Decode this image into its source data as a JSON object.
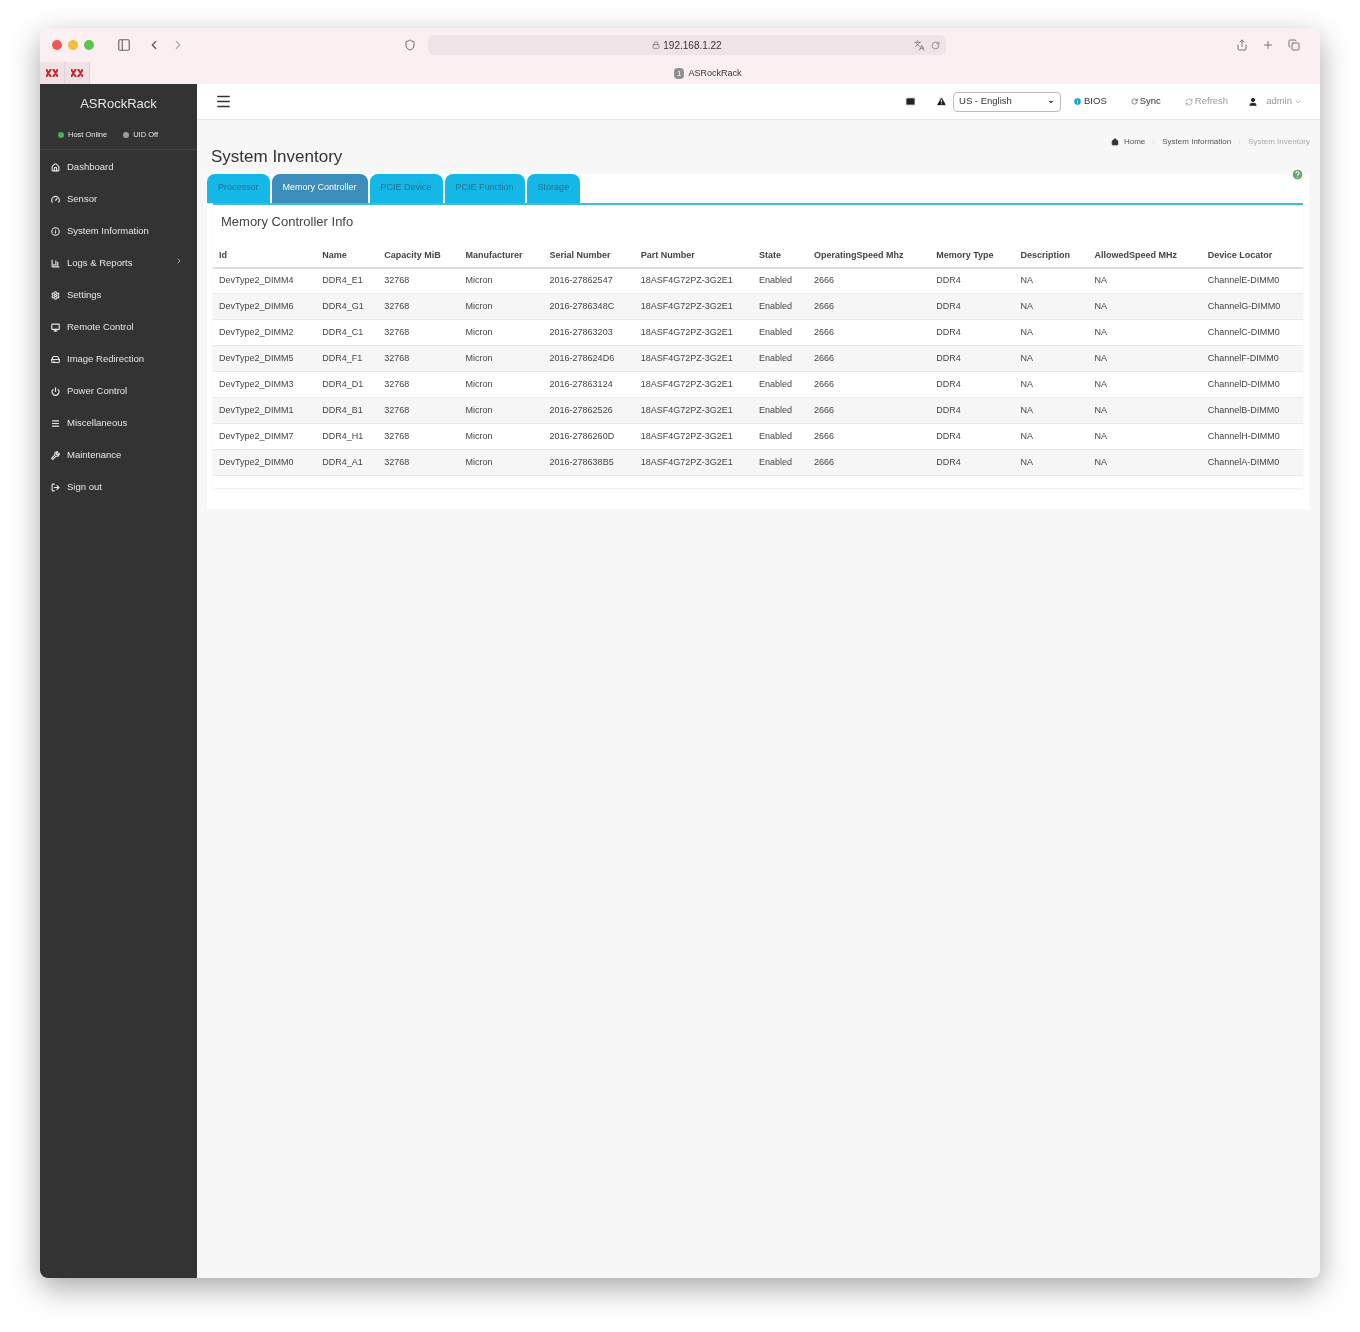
{
  "browser": {
    "url": "192.168.1.22",
    "tab_badge": "1",
    "tab_title": "ASRockRack"
  },
  "sidebar": {
    "brand": "ASRockRack",
    "status": [
      {
        "label": "Host Online",
        "color": "#4caf50"
      },
      {
        "label": "UID Off",
        "color": "#9e9e9e"
      }
    ],
    "items": [
      {
        "label": "Dashboard",
        "submenu": false
      },
      {
        "label": "Sensor",
        "submenu": false
      },
      {
        "label": "System Information",
        "submenu": false
      },
      {
        "label": "Logs & Reports",
        "submenu": true
      },
      {
        "label": "Settings",
        "submenu": false
      },
      {
        "label": "Remote Control",
        "submenu": false
      },
      {
        "label": "Image Redirection",
        "submenu": false
      },
      {
        "label": "Power Control",
        "submenu": false
      },
      {
        "label": "Miscellaneous",
        "submenu": false
      },
      {
        "label": "Maintenance",
        "submenu": false
      },
      {
        "label": "Sign out",
        "submenu": false
      }
    ]
  },
  "header": {
    "language": "US - English",
    "actions": [
      "BIOS",
      "Sync",
      "Refresh"
    ],
    "user": "admin"
  },
  "breadcrumb": [
    "Home",
    "System Information",
    "System Inventory"
  ],
  "page_title": "System Inventory",
  "tabs": [
    {
      "label": "Processor",
      "selected": false
    },
    {
      "label": "Memory Controller",
      "selected": true
    },
    {
      "label": "PCIE Device",
      "selected": false
    },
    {
      "label": "PCIE Function",
      "selected": false
    },
    {
      "label": "Storage",
      "selected": false
    }
  ],
  "panel_title": "Memory Controller Info",
  "table": {
    "columns": [
      "Id",
      "Name",
      "Capacity MiB",
      "Manufacturer",
      "Serial Number",
      "Part Number",
      "State",
      "OperatingSpeed Mhz",
      "Memory Type",
      "Description",
      "AllowedSpeed MHz",
      "Device Locator"
    ],
    "rows": [
      [
        "DevType2_DIMM4",
        "DDR4_E1",
        "32768",
        "Micron",
        "2016-27862547",
        "18ASF4G72PZ-3G2E1",
        "Enabled",
        "2666",
        "DDR4",
        "NA",
        "NA",
        "ChannelE-DIMM0"
      ],
      [
        "DevType2_DIMM6",
        "DDR4_G1",
        "32768",
        "Micron",
        "2016-2786348C",
        "18ASF4G72PZ-3G2E1",
        "Enabled",
        "2666",
        "DDR4",
        "NA",
        "NA",
        "ChannelG-DIMM0"
      ],
      [
        "DevType2_DIMM2",
        "DDR4_C1",
        "32768",
        "Micron",
        "2016-27863203",
        "18ASF4G72PZ-3G2E1",
        "Enabled",
        "2666",
        "DDR4",
        "NA",
        "NA",
        "ChannelC-DIMM0"
      ],
      [
        "DevType2_DIMM5",
        "DDR4_F1",
        "32768",
        "Micron",
        "2016-278624D6",
        "18ASF4G72PZ-3G2E1",
        "Enabled",
        "2666",
        "DDR4",
        "NA",
        "NA",
        "ChannelF-DIMM0"
      ],
      [
        "DevType2_DIMM3",
        "DDR4_D1",
        "32768",
        "Micron",
        "2016-27863124",
        "18ASF4G72PZ-3G2E1",
        "Enabled",
        "2666",
        "DDR4",
        "NA",
        "NA",
        "ChannelD-DIMM0"
      ],
      [
        "DevType2_DIMM1",
        "DDR4_B1",
        "32768",
        "Micron",
        "2016-27862526",
        "18ASF4G72PZ-3G2E1",
        "Enabled",
        "2666",
        "DDR4",
        "NA",
        "NA",
        "ChannelB-DIMM0"
      ],
      [
        "DevType2_DIMM7",
        "DDR4_H1",
        "32768",
        "Micron",
        "2016-2786260D",
        "18ASF4G72PZ-3G2E1",
        "Enabled",
        "2666",
        "DDR4",
        "NA",
        "NA",
        "ChannelH-DIMM0"
      ],
      [
        "DevType2_DIMM0",
        "DDR4_A1",
        "32768",
        "Micron",
        "2016-278638B5",
        "18ASF4G72PZ-3G2E1",
        "Enabled",
        "2666",
        "DDR4",
        "NA",
        "NA",
        "ChannelA-DIMM0"
      ]
    ]
  }
}
